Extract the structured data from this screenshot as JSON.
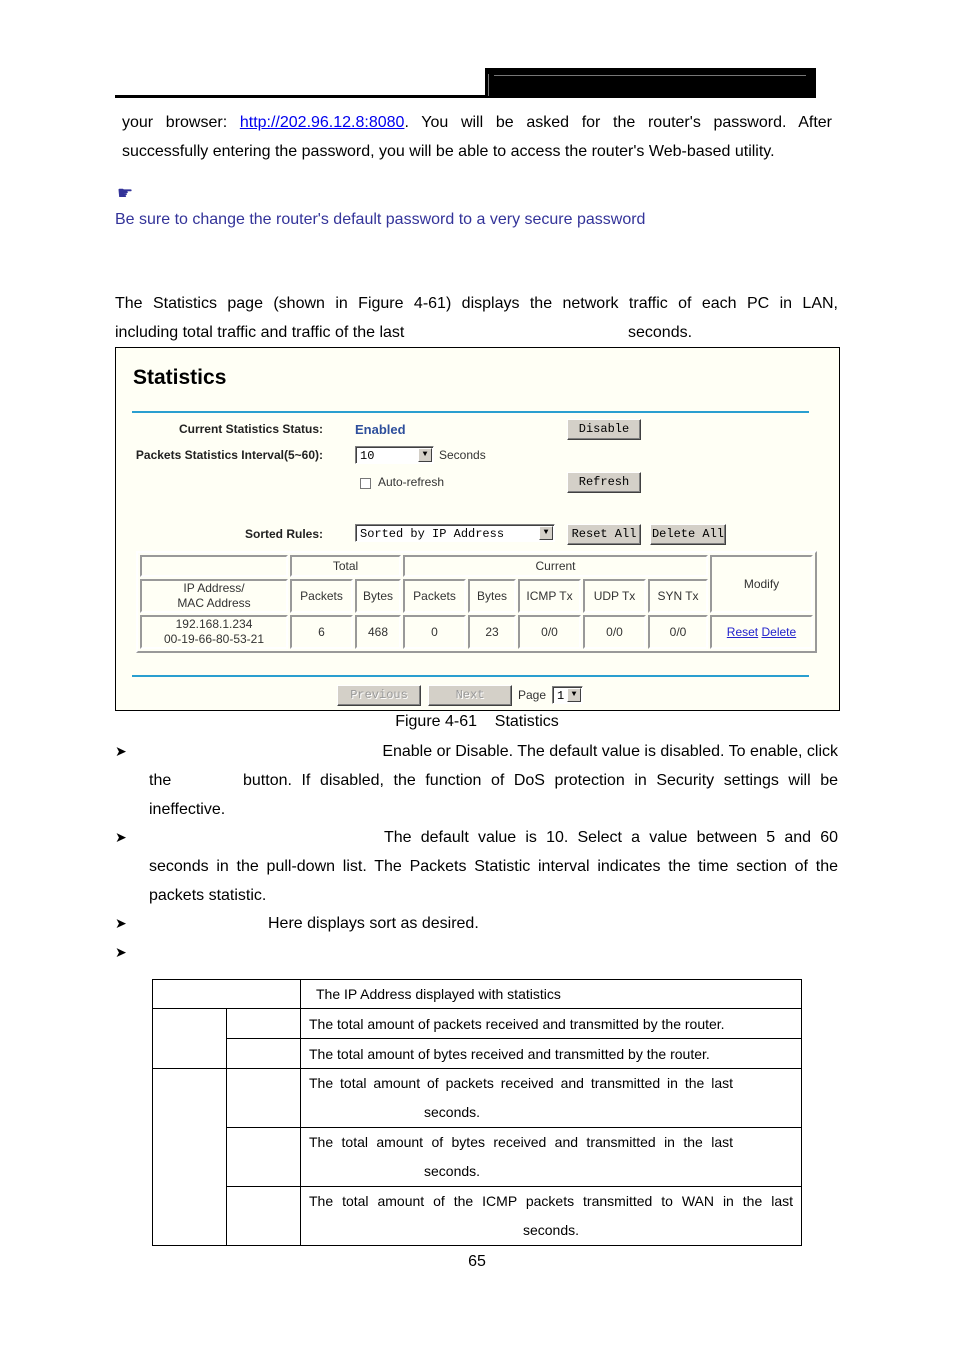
{
  "header": {},
  "intro": {
    "line1_prefix": "your browser: ",
    "url": "http://202.96.12.8:8080",
    "line1_suffix": ". You will be asked for the router's password. After",
    "line2": "successfully entering the password, you will be able to access the router's Web-based utility."
  },
  "note": {
    "icon": "pointing-hand-icon",
    "text": "Be sure to change the router's default password to a very secure password"
  },
  "section": {
    "line1": "The Statistics page (shown in Figure 4-61) displays the network traffic of each PC in LAN,",
    "line2_prefix": "including total traffic and traffic of the last",
    "line2_suffix": "seconds."
  },
  "figure": {
    "title": "Statistics",
    "status_label": "Current Statistics Status:",
    "status_value": "Enabled",
    "disable_button": "Disable",
    "interval_label": "Packets Statistics Interval(5~60):",
    "interval_value": "10",
    "interval_unit": "Seconds",
    "auto_refresh_label": "Auto-refresh",
    "auto_refresh_checked": false,
    "refresh_button": "Refresh",
    "sorted_rules_label": "Sorted Rules:",
    "sorted_rules_value": "Sorted by IP Address",
    "reset_all_button": "Reset All",
    "delete_all_button": "Delete All",
    "table": {
      "group_total": "Total",
      "group_current": "Current",
      "modify": "Modify",
      "ip_mac_header_1": "IP Address/",
      "ip_mac_header_2": "MAC Address",
      "columns": [
        "Packets",
        "Bytes",
        "Packets",
        "Bytes",
        "ICMP Tx",
        "UDP Tx",
        "SYN Tx"
      ],
      "rows": [
        {
          "ip": "192.168.1.234",
          "mac": "00-19-66-80-53-21",
          "total_packets": "6",
          "total_bytes": "468",
          "current_packets": "0",
          "current_bytes": "23",
          "icmp_tx": "0/0",
          "udp_tx": "0/0",
          "syn_tx": "0/0",
          "reset_link": "Reset",
          "delete_link": "Delete"
        }
      ]
    },
    "previous_button": "Previous",
    "next_button": "Next",
    "page_label": "Page",
    "page_value": "1"
  },
  "caption": "Figure 4-61    Statistics",
  "bullets": [
    {
      "line1": "Enable or Disable. The default value is disabled. To enable, click",
      "line2_prefix": "the",
      "line2_suffix": "button. If disabled, the function of DoS protection in Security settings will be",
      "line3": "ineffective."
    },
    {
      "line1": "The default value is 10. Select a value between 5 and 60",
      "line2": "seconds in the pull-down list. The Packets Statistic interval indicates the time section of the",
      "line3": "packets statistic."
    },
    {
      "line1": "Here displays sort as desired."
    },
    {
      "line1": ""
    }
  ],
  "desc_table": [
    {
      "text": "The IP Address displayed with statistics"
    },
    {
      "text": "The total amount of packets received and transmitted by the router."
    },
    {
      "text": "The total amount of bytes received and transmitted by the router."
    },
    {
      "text": "The total amount of packets received and transmitted in the last",
      "text2": "seconds."
    },
    {
      "text": "The total amount of bytes received and transmitted in the last",
      "text2": "seconds."
    },
    {
      "text": "The total amount of the ICMP packets transmitted to WAN in the last",
      "text2": "seconds."
    }
  ],
  "page_number": "65"
}
